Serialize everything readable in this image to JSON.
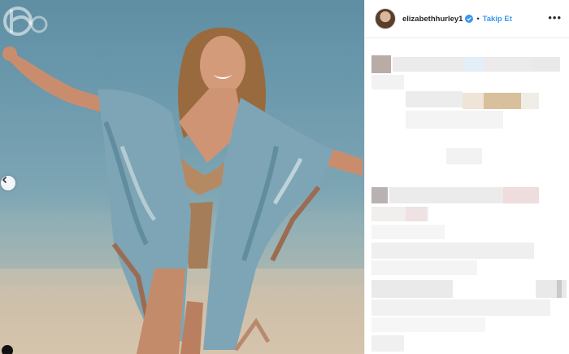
{
  "post": {
    "username": "elizabethhurley1",
    "separator": "•",
    "follow_label": "Takip Et",
    "more_label": "•••"
  },
  "icons": {
    "avatar": "avatar",
    "verified": "verified-badge-icon",
    "more": "more-options-icon",
    "prev": "chevron-left-icon",
    "watermark": "watermark-logo"
  },
  "colors": {
    "follow": "#3897f0",
    "verified": "#3897f0",
    "text": "#262626",
    "sea": "#6e9bae",
    "sand": "#d7c3ab"
  }
}
